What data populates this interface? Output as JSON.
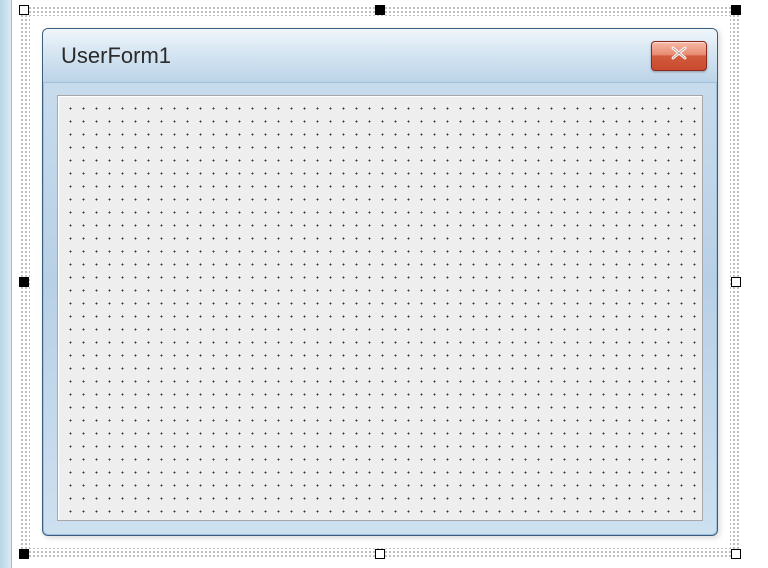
{
  "form": {
    "title": "UserForm1"
  }
}
